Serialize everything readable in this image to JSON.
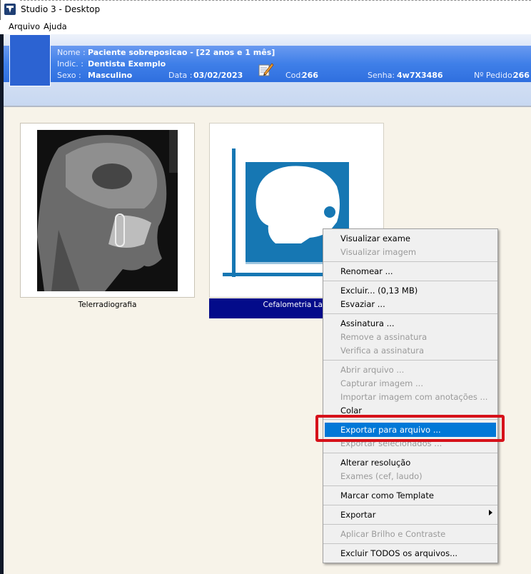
{
  "window": {
    "title": "Studio 3 - Desktop"
  },
  "menubar": {
    "items": [
      "Arquivo",
      "Ajuda"
    ]
  },
  "patient": {
    "nome_label": "Nome :",
    "nome_value": "Paciente sobreposicao - [22 anos e 1 mês]",
    "indic_label": "Indic. :",
    "indic_value": "Dentista Exemplo",
    "sexo_label": "Sexo :",
    "sexo_value": "Masculino",
    "data_label": "Data :",
    "data_value": "03/02/2023",
    "cod_label": "Cod:",
    "cod_value": "266",
    "senha_label": "Senha:",
    "senha_value": "4w7X3486",
    "pedido_label": "Nº Pedido:",
    "pedido_value": "266"
  },
  "thumbnails": [
    {
      "caption": "Telerradiografia",
      "selected": false
    },
    {
      "caption": "Cefalometria Late",
      "selected": true
    }
  ],
  "context_menu": {
    "items": [
      {
        "label": "Visualizar exame",
        "enabled": true
      },
      {
        "label": "Visualizar imagem",
        "enabled": false
      },
      {
        "label": "Renomear ...",
        "enabled": true
      },
      {
        "label": "Excluir... (0,13 MB)",
        "enabled": true
      },
      {
        "label": "Esvaziar ...",
        "enabled": true
      },
      {
        "label": "Assinatura ...",
        "enabled": true
      },
      {
        "label": "Remove a assinatura",
        "enabled": false
      },
      {
        "label": "Verifica a assinatura",
        "enabled": false
      },
      {
        "label": "Abrir arquivo ...",
        "enabled": false
      },
      {
        "label": "Capturar imagem ...",
        "enabled": false
      },
      {
        "label": "Importar imagem com anotações ...",
        "enabled": false
      },
      {
        "label": "Colar",
        "enabled": true
      },
      {
        "label": "Exportar para arquivo ...",
        "enabled": true,
        "highlighted": true
      },
      {
        "label": "Exportar selecionados ...",
        "enabled": false
      },
      {
        "label": "Alterar resolução",
        "enabled": true
      },
      {
        "label": "Exames (cef, laudo)",
        "enabled": false
      },
      {
        "label": "Marcar como Template",
        "enabled": true
      },
      {
        "label": "Exportar",
        "enabled": true,
        "submenu": true
      },
      {
        "label": "Aplicar Brilho e Contraste",
        "enabled": false
      },
      {
        "label": "Excluir TODOS os arquivos...",
        "enabled": true
      }
    ]
  },
  "colors": {
    "header_band": "#3f7fe8",
    "selection": "#0078d7",
    "caption_selected": "#030b8a",
    "annotation": "#d6111a"
  }
}
